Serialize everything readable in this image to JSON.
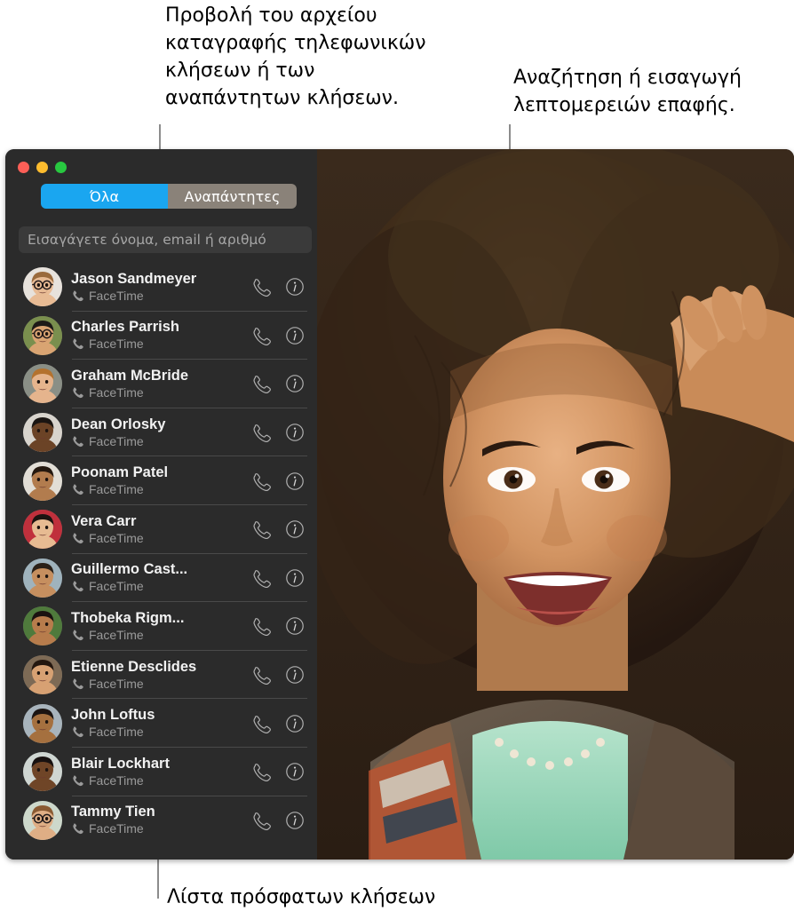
{
  "annotations": {
    "calls_log": "Προβολή του αρχείου\nκαταγραφής τηλεφωνικών\nκλήσεων ή των\nαναπάντητων κλήσεων.",
    "search_contact": "Αναζήτηση ή εισαγωγή\nλεπτομερειών επαφής.",
    "recents_list": "Λίστα πρόσφατων κλήσεων"
  },
  "window": {
    "traffic_lights": [
      {
        "name": "close",
        "color": "#fc5f57"
      },
      {
        "name": "minimize",
        "color": "#fdbc2e"
      },
      {
        "name": "zoom",
        "color": "#28c840"
      }
    ]
  },
  "sidebar": {
    "segmented_control": {
      "selected": "Όλα",
      "segments": [
        {
          "label": "Όλα",
          "selected": true,
          "color": "#1aa6f0"
        },
        {
          "label": "Αναπάντητες",
          "selected": false,
          "color": "#8a8279"
        }
      ]
    },
    "search": {
      "value": "",
      "placeholder": "Εισαγάγετε όνομα, email ή αριθμό"
    },
    "call_list": [
      {
        "name": "Jason Sandmeyer",
        "type": "FaceTime",
        "call_icon": "phone-handset-icon",
        "info_icon": "info-circle-icon"
      },
      {
        "name": "Charles Parrish",
        "type": "FaceTime",
        "call_icon": "phone-handset-icon",
        "info_icon": "info-circle-icon"
      },
      {
        "name": "Graham McBride",
        "type": "FaceTime",
        "call_icon": "phone-handset-icon",
        "info_icon": "info-circle-icon"
      },
      {
        "name": "Dean Orlosky",
        "type": "FaceTime",
        "call_icon": "phone-handset-icon",
        "info_icon": "info-circle-icon"
      },
      {
        "name": "Poonam Patel",
        "type": "FaceTime",
        "call_icon": "phone-handset-icon",
        "info_icon": "info-circle-icon"
      },
      {
        "name": "Vera Carr",
        "type": "FaceTime",
        "call_icon": "phone-handset-icon",
        "info_icon": "info-circle-icon"
      },
      {
        "name": "Guillermo Cast...",
        "type": "FaceTime",
        "call_icon": "phone-handset-icon",
        "info_icon": "info-circle-icon"
      },
      {
        "name": "Thobeka Rigm...",
        "type": "FaceTime",
        "call_icon": "phone-handset-icon",
        "info_icon": "info-circle-icon"
      },
      {
        "name": "Etienne Desclides",
        "type": "FaceTime",
        "call_icon": "phone-handset-icon",
        "info_icon": "info-circle-icon"
      },
      {
        "name": "John Loftus",
        "type": "FaceTime",
        "call_icon": "phone-handset-icon",
        "info_icon": "info-circle-icon"
      },
      {
        "name": "Blair Lockhart",
        "type": "FaceTime",
        "call_icon": "phone-handset-icon",
        "info_icon": "info-circle-icon"
      },
      {
        "name": "Tammy Tien",
        "type": "FaceTime",
        "call_icon": "phone-handset-icon",
        "info_icon": "info-circle-icon"
      }
    ]
  },
  "video_panel": {
    "description": "Smiling woman with curly hair holding her hand to her head"
  },
  "colors": {
    "window_background": "#2b2b2b",
    "accent_blue": "#1aa6f0",
    "segment_inactive": "#8a8279",
    "search_background": "#3a3a3a",
    "primary_text": "#f2f2f2",
    "secondary_text": "#9a9a9a",
    "leader_line": "#8c8c8c"
  }
}
